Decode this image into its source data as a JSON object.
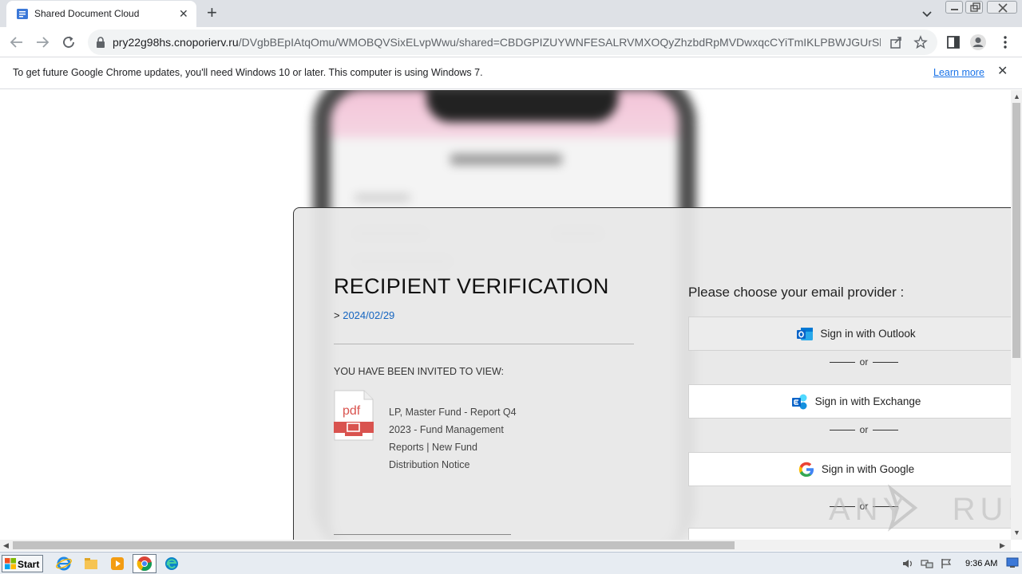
{
  "browser": {
    "tab_title": "Shared Document Cloud",
    "url_host": "pry22g98hs.cnoporierv.ru",
    "url_path": "/DVgbBEpIAtqOmu/WMOBQVSixELvpWwu/shared=CBDGPIZUYWNFESALRVMXOQyZhzbdRpMVDwxqcCYiTmIKLPBWJGUrSlFXo..."
  },
  "infobar": {
    "message": "To get future Google Chrome updates, you'll need Windows 10 or later. This computer is using Windows 7.",
    "link": "Learn more"
  },
  "page": {
    "title": "RECIPIENT VERIFICATION",
    "date_prefix": ">",
    "date": "2024/02/29",
    "invited_label": "YOU HAVE BEEN INVITED TO VIEW:",
    "pdf_label": "pdf",
    "document_title": "LP, Master Fund - Report Q4 2023 - Fund Management Reports | New Fund Distribution Notice",
    "choose_provider": "Please choose your email provider :",
    "providers": [
      {
        "label": "Sign in with Outlook",
        "icon": "outlook-icon"
      },
      {
        "label": "Sign in with Exchange",
        "icon": "exchange-icon"
      },
      {
        "label": "Sign in with Google",
        "icon": "google-icon"
      }
    ],
    "separator": "or"
  },
  "watermark": {
    "text": "ANY RUN"
  },
  "taskbar": {
    "start_label": "Start",
    "clock": "9:36 AM"
  },
  "colors": {
    "link_blue": "#1a73e8",
    "date_blue": "#1565c0",
    "pdf_red": "#d9534f",
    "outlook_blue": "#0a64c8"
  }
}
